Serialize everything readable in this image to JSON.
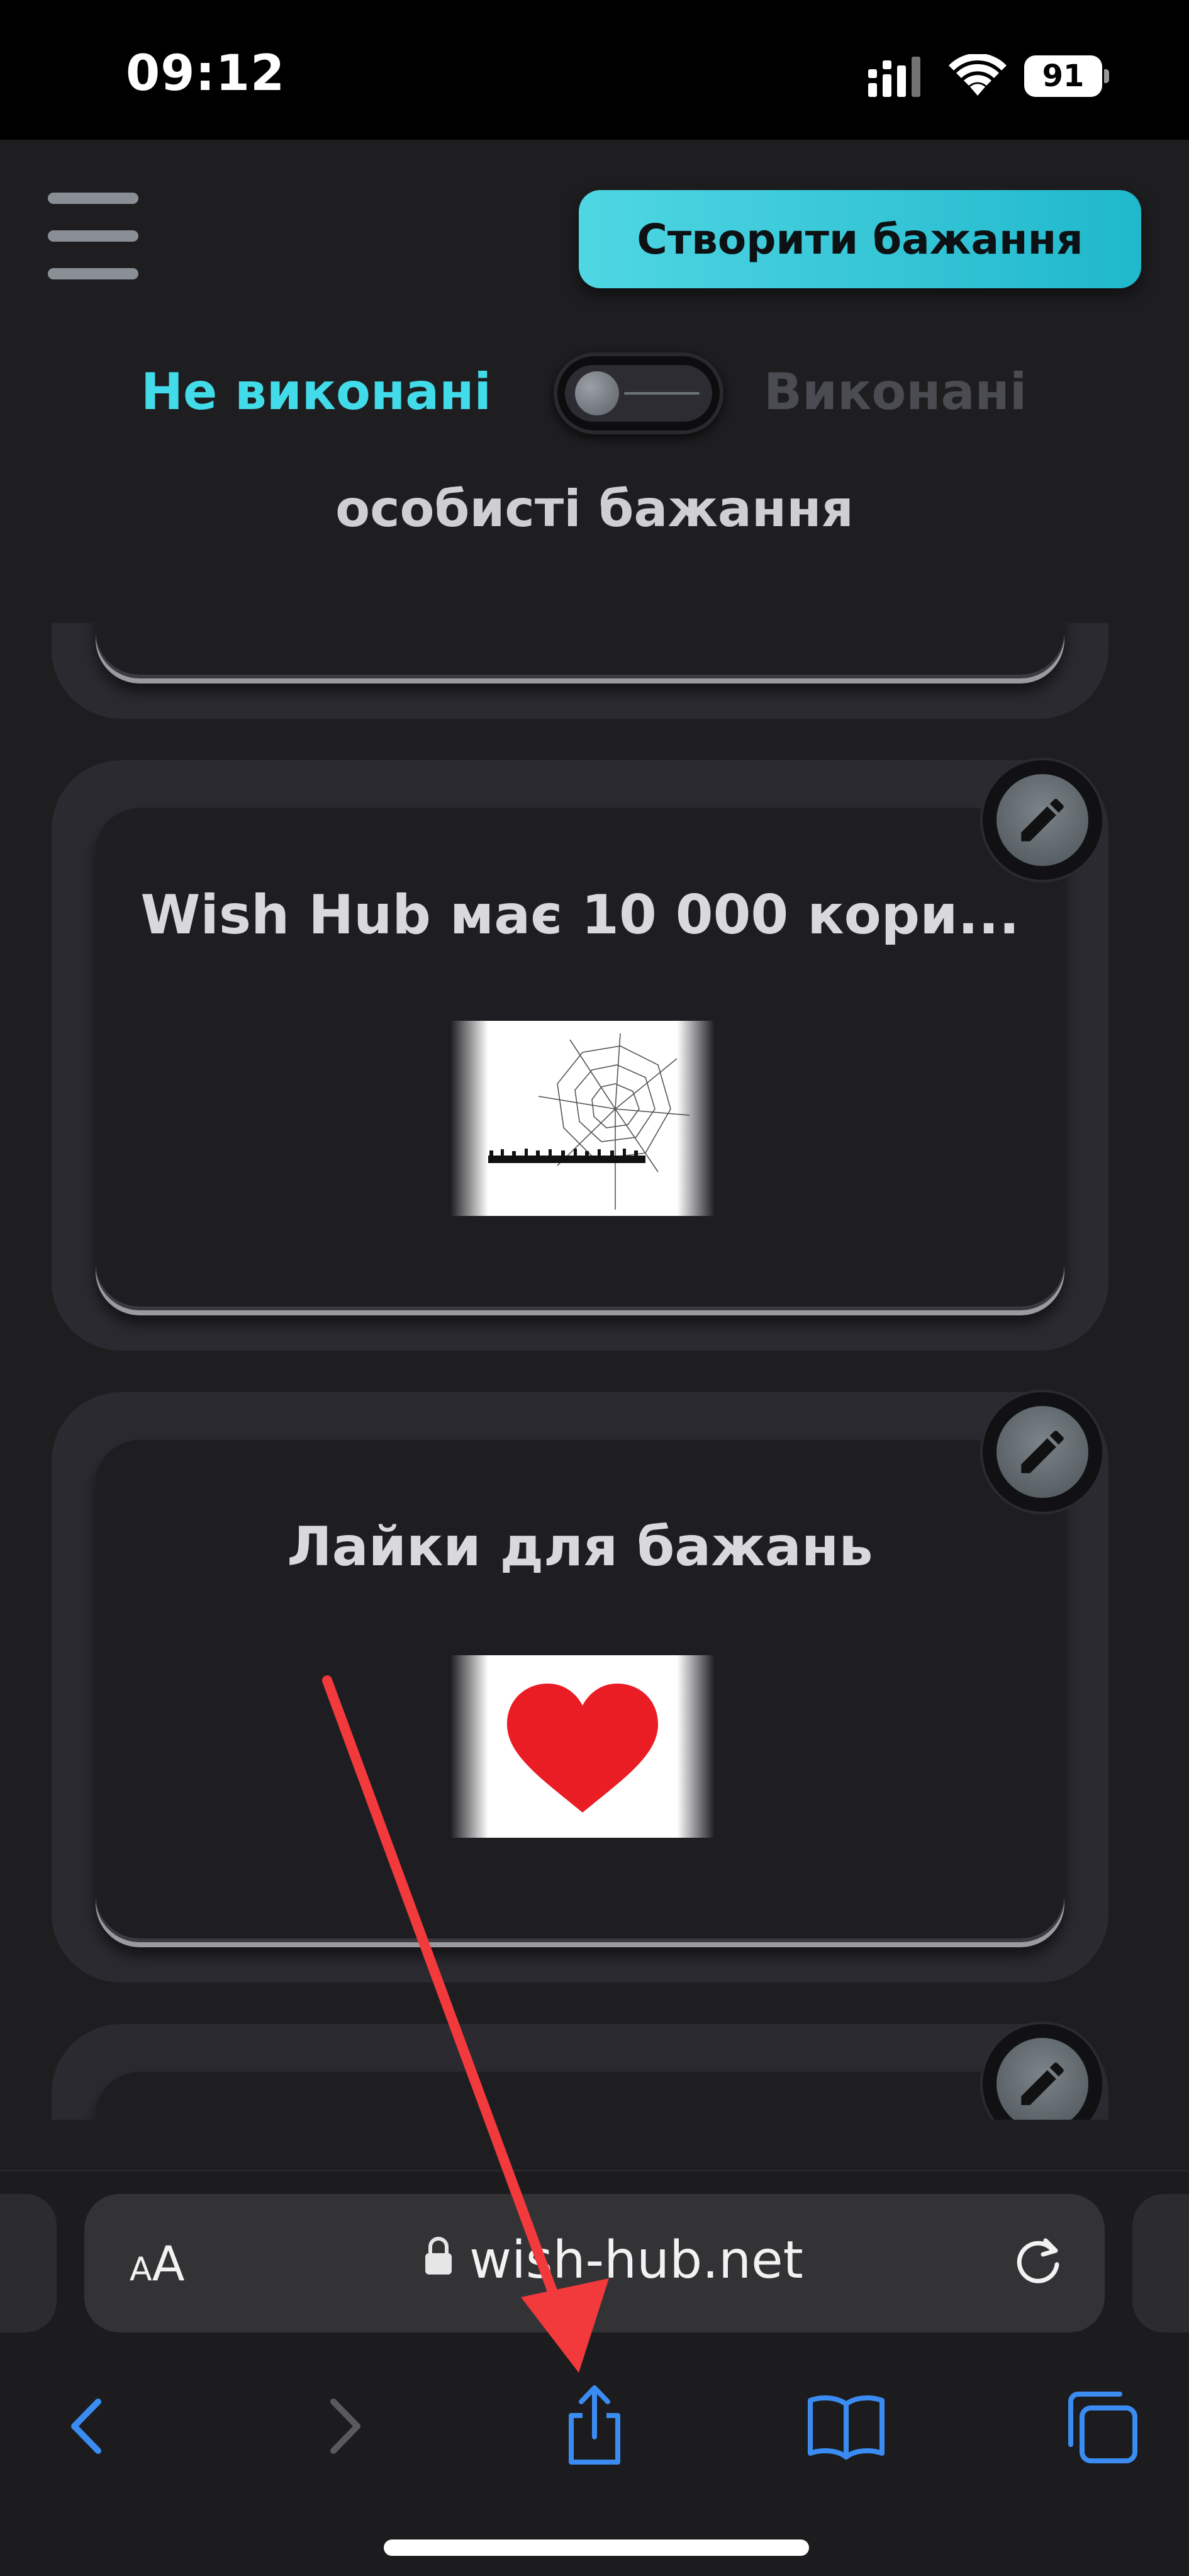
{
  "status_bar": {
    "time": "09:12",
    "battery_level": "91",
    "signal_icon": "cellular-signal-icon",
    "wifi_icon": "wifi-icon"
  },
  "header": {
    "menu_icon": "hamburger-menu-icon",
    "create_wish_label": "Створити бажання"
  },
  "filter": {
    "not_done_label": "Не виконані",
    "done_label": "Виконані",
    "toggle_state": "off",
    "active_color": "#42dbe9"
  },
  "section_title": "особисті бажання",
  "wishes": [
    {
      "title": "Wish Hub має 10 000 кори...",
      "image": "spider-web-image",
      "edit_icon": "pencil-icon"
    },
    {
      "title": "Лайки для бажань",
      "image": "red-heart-image",
      "edit_icon": "pencil-icon"
    }
  ],
  "browser": {
    "text_size_label_small": "A",
    "text_size_label_large": "A",
    "url": "wish-hub.net",
    "lock_icon": "lock-icon",
    "reload_icon": "reload-icon",
    "toolbar": [
      "back-icon",
      "forward-icon",
      "share-icon",
      "bookmarks-icon",
      "tabs-icon"
    ]
  },
  "colors": {
    "accent": "#42dbe9",
    "background": "#1e1e20",
    "annotation_arrow": "#f2393c",
    "ios_blue": "#3b8cf2"
  }
}
